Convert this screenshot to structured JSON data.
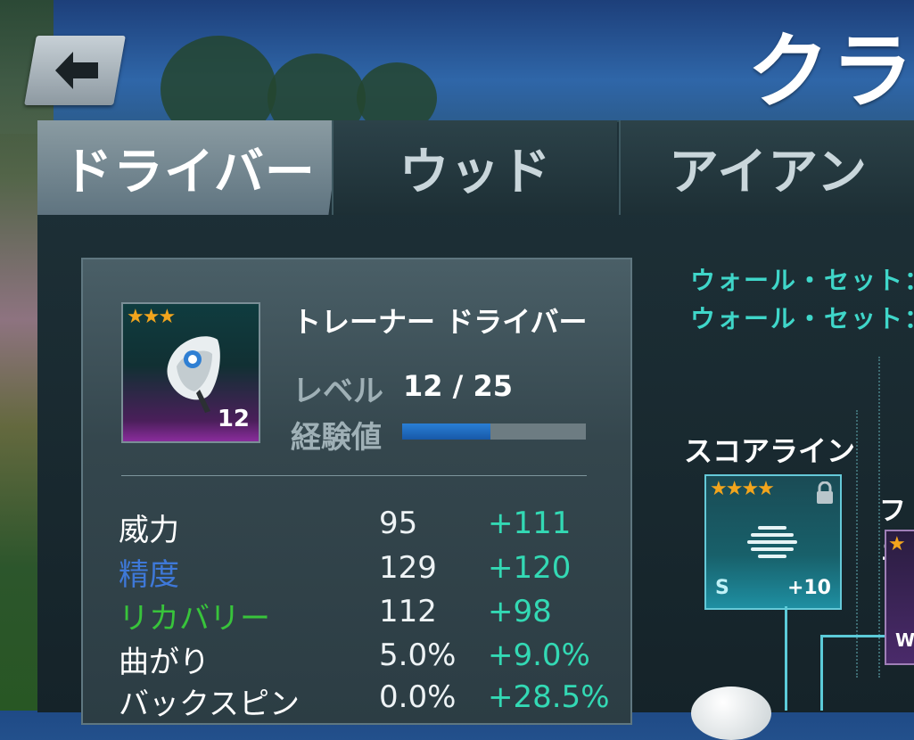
{
  "header": {
    "title": "クラ",
    "back_label": "back"
  },
  "tabs": [
    {
      "label": "ドライバー",
      "active": true
    },
    {
      "label": "ウッド",
      "active": false
    },
    {
      "label": "アイアン",
      "active": false
    }
  ],
  "item": {
    "stars": "★★★",
    "name": "トレーナー ドライバー",
    "badge_level": "12",
    "level_label": "レベル",
    "level_value": "12 / 25",
    "exp_label": "経験値",
    "exp_progress": 0.48
  },
  "stats": [
    {
      "name": "威力",
      "base": "95",
      "bonus": "+111",
      "color": "#ffffff"
    },
    {
      "name": "精度",
      "base": "129",
      "bonus": "+120",
      "color": "#3e78d8"
    },
    {
      "name": "リカバリー",
      "base": "112",
      "bonus": "+98",
      "color": "#38c43b"
    },
    {
      "name": "曲がり",
      "base": "5.0%",
      "bonus": "+9.0%",
      "color": "#ffffff"
    },
    {
      "name": "バックスピン",
      "base": "0.0%",
      "bonus": "+28.5%",
      "color": "#ffffff"
    }
  ],
  "info_lines": [
    "ウォール・セット：",
    "ウォール・セット："
  ],
  "upgrades": {
    "score_line": {
      "title": "スコアライン",
      "stars": "★★★★",
      "tag": "S",
      "bonus": "+10"
    },
    "second": {
      "title": "フェ",
      "stars": "★",
      "tag": "W"
    }
  },
  "colors": {
    "accent": "#3fd6c9",
    "bonus": "#33d9b4",
    "star": "#f2a51d",
    "exp_bar": "#2a7fd6"
  }
}
